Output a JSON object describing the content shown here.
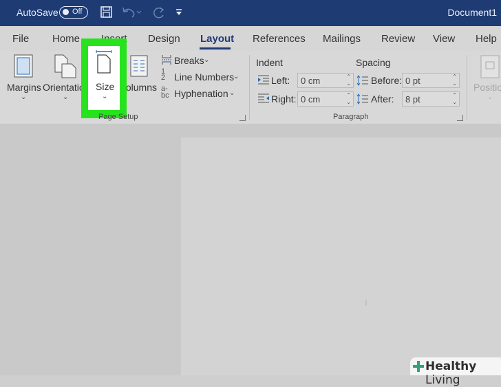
{
  "titlebar": {
    "autosave_label": "AutoSave",
    "toggle_state": "Off",
    "document_title": "Document1"
  },
  "tabs": [
    {
      "label": "File"
    },
    {
      "label": "Home"
    },
    {
      "label": "Insert"
    },
    {
      "label": "Design"
    },
    {
      "label": "Layout"
    },
    {
      "label": "References"
    },
    {
      "label": "Mailings"
    },
    {
      "label": "Review"
    },
    {
      "label": "View"
    },
    {
      "label": "Help"
    }
  ],
  "active_tab": "Layout",
  "ribbon": {
    "page_setup": {
      "margins_label": "Margins",
      "orientation_label": "Orientation",
      "size_label": "Size",
      "columns_label": "Columns",
      "breaks_label": "Breaks",
      "line_numbers_label": "Line Numbers",
      "hyphenation_label": "Hyphenation",
      "group_label": "Page Setup"
    },
    "paragraph": {
      "indent_heading": "Indent",
      "spacing_heading": "Spacing",
      "left_label": "Left:",
      "left_value": "0 cm",
      "right_label": "Right:",
      "right_value": "0 cm",
      "before_label": "Before:",
      "before_value": "0 pt",
      "after_label": "After:",
      "after_value": "8 pt",
      "group_label": "Paragraph"
    },
    "arrange": {
      "position_label": "Position"
    }
  },
  "watermark": {
    "brand_bold": "Healthy",
    "brand_light": "Living"
  },
  "colors": {
    "titlebar": "#1f3b73",
    "highlight": "#27e31e",
    "accent": "#1f3b73"
  }
}
